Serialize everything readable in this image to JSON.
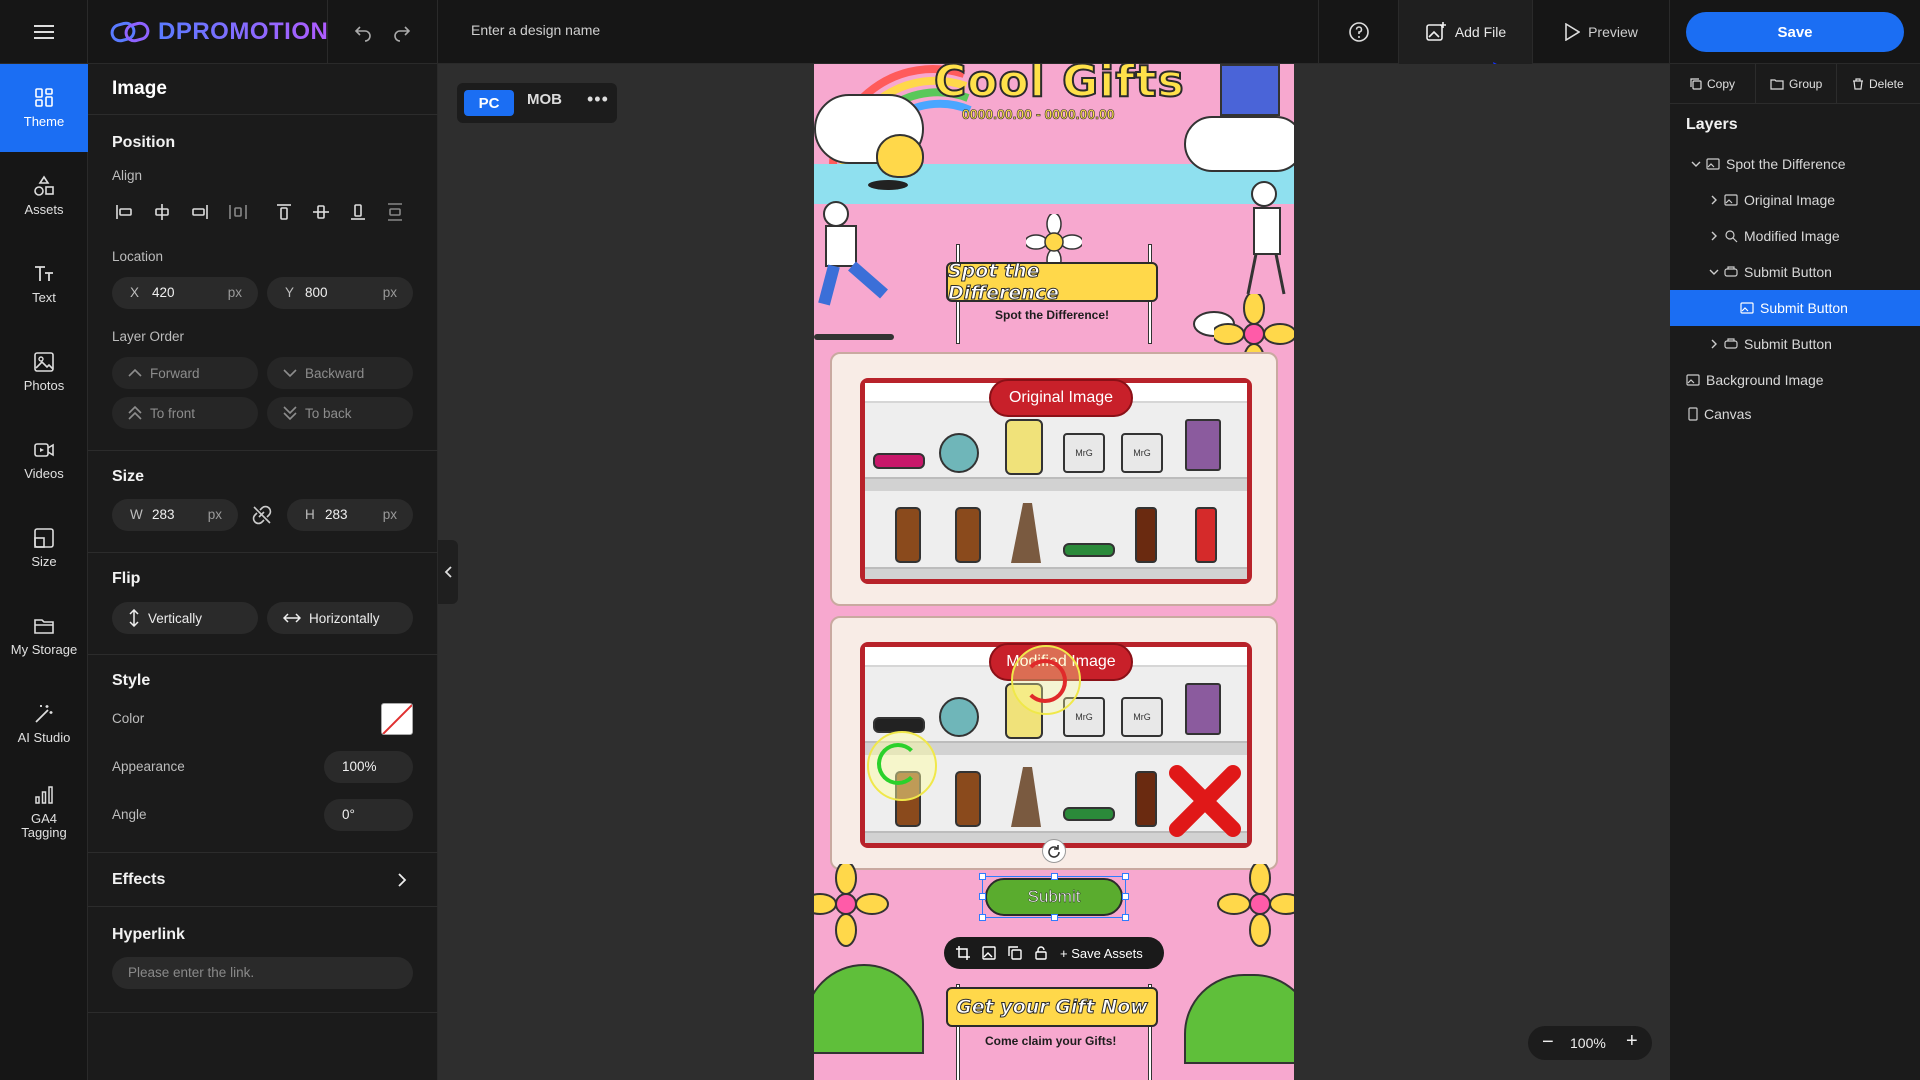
{
  "topbar": {
    "logo": "DPROMOTION",
    "design_name": "Enter a design name",
    "add_file": "Add File",
    "preview": "Preview",
    "save": "Save"
  },
  "rail": [
    {
      "label": "Theme",
      "icon": "theme-icon"
    },
    {
      "label": "Assets",
      "icon": "assets-icon"
    },
    {
      "label": "Text",
      "icon": "text-icon"
    },
    {
      "label": "Photos",
      "icon": "photos-icon"
    },
    {
      "label": "Videos",
      "icon": "videos-icon"
    },
    {
      "label": "Size",
      "icon": "size-icon"
    },
    {
      "label": "My Storage",
      "icon": "folder-icon"
    },
    {
      "label": "AI Studio",
      "icon": "magic-wand-icon"
    },
    {
      "label": "GA4\nTagging",
      "icon": "bar-chart-icon"
    }
  ],
  "props": {
    "title": "Image",
    "position": {
      "title": "Position",
      "align_label": "Align",
      "location_label": "Location",
      "x_prefix": "X",
      "x_value": "420",
      "x_unit": "px",
      "y_prefix": "Y",
      "y_value": "800",
      "y_unit": "px",
      "layer_order_label": "Layer Order",
      "forward": "Forward",
      "backward": "Backward",
      "to_front": "To front",
      "to_back": "To back"
    },
    "size": {
      "title": "Size",
      "w_prefix": "W",
      "w_value": "283",
      "w_unit": "px",
      "h_prefix": "H",
      "h_value": "283",
      "h_unit": "px"
    },
    "flip": {
      "title": "Flip",
      "vertically": "Vertically",
      "horizontally": "Horizontally"
    },
    "style": {
      "title": "Style",
      "color_label": "Color",
      "appearance_label": "Appearance",
      "appearance_value": "100%",
      "angle_label": "Angle",
      "angle_value": "0°"
    },
    "effects": {
      "title": "Effects"
    },
    "hyperlink": {
      "title": "Hyperlink",
      "placeholder": "Please enter the link."
    }
  },
  "device": {
    "pc": "PC",
    "mob": "MOB"
  },
  "artboard": {
    "title": "Cool Gifts",
    "date_range": "0000.00.00 - 0000.00.00",
    "banner1": "Spot the Difference",
    "banner1_sub": "Spot the Difference!",
    "original_label": "Original Image",
    "modified_label": "Modified Image",
    "submit": "Submit",
    "save_assets": "Save Assets",
    "banner2": "Get your Gift Now",
    "banner2_sub": "Come claim your Gifts!",
    "mug_text": "MrG"
  },
  "zoom": {
    "value": "100%"
  },
  "layers": {
    "copy": "Copy",
    "group": "Group",
    "delete": "Delete",
    "title": "Layers",
    "items": [
      {
        "label": "Spot the Difference"
      },
      {
        "label": "Original Image"
      },
      {
        "label": "Modified Image"
      },
      {
        "label": "Submit Button"
      },
      {
        "label": "Submit Button"
      },
      {
        "label": "Submit Button"
      },
      {
        "label": "Background Image"
      },
      {
        "label": "Canvas"
      }
    ]
  },
  "colors": {
    "accent": "#1b6ef3",
    "panel": "#1b1b1b",
    "artboard_bg": "#f7a8cf",
    "frame_red": "#b8222a",
    "submit_green": "#5aac2e"
  }
}
